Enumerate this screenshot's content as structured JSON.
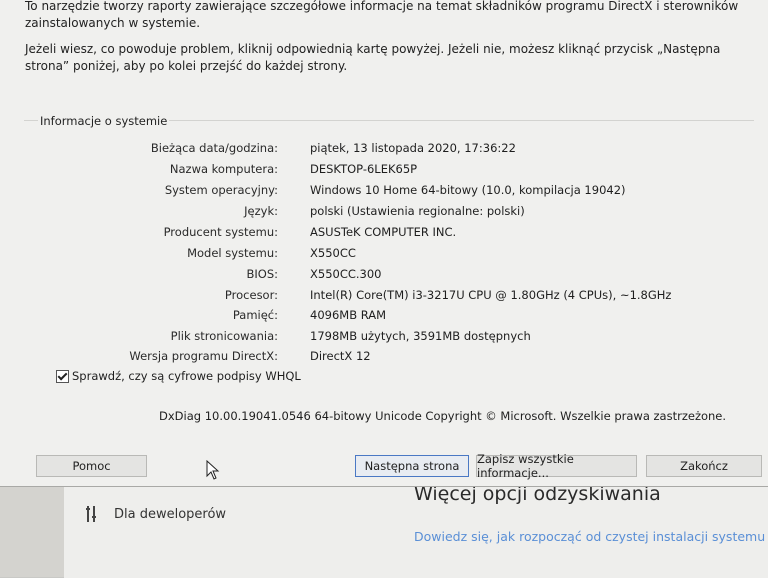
{
  "intro": {
    "line1": "To narzędzie tworzy raporty zawierające szczegółowe informacje na temat składników programu DirectX i sterowników zainstalowanych w systemie.",
    "line2": "Jeżeli wiesz, co powoduje problem, kliknij odpowiednią kartę powyżej. Jeżeli nie, możesz kliknąć przycisk „Następna strona” poniżej, aby po kolei przejść do każdej strony."
  },
  "system_info": {
    "group_label": "Informacje o systemie",
    "rows": [
      {
        "label": "Bieżąca data/godzina:",
        "value": "piątek, 13 listopada 2020, 17:36:22"
      },
      {
        "label": "Nazwa komputera:",
        "value": "DESKTOP-6LEK65P"
      },
      {
        "label": "System operacyjny:",
        "value": "Windows 10 Home 64-bitowy (10.0, kompilacja 19042)"
      },
      {
        "label": "Język:",
        "value": "polski (Ustawienia regionalne: polski)"
      },
      {
        "label": "Producent systemu:",
        "value": "ASUSTeK COMPUTER INC."
      },
      {
        "label": "Model systemu:",
        "value": "X550CC"
      },
      {
        "label": "BIOS:",
        "value": "X550CC.300"
      },
      {
        "label": "Procesor:",
        "value": "Intel(R) Core(TM) i3-3217U CPU @ 1.80GHz (4 CPUs), ~1.8GHz"
      },
      {
        "label": "Pamięć:",
        "value": "4096MB RAM"
      },
      {
        "label": "Plik stronicowania:",
        "value": "1798MB użytych, 3591MB dostępnych"
      },
      {
        "label": "Wersja programu DirectX:",
        "value": "DirectX 12"
      }
    ],
    "whql_checkbox_label": "Sprawdź, czy są cyfrowe podpisy WHQL",
    "whql_checked": true,
    "copyright": "DxDiag 10.00.19041.0546 64-bitowy Unicode  Copyright © Microsoft. Wszelkie prawa zastrzeżone."
  },
  "buttons": {
    "help": "Pomoc",
    "next_page": "Następna strona",
    "save_all": "Zapisz wszystkie informacje...",
    "exit": "Zakończ"
  },
  "background_window": {
    "heading": "Więcej opcji odzyskiwania",
    "link": "Dowiedz się, jak rozpocząć od czystej instalacji systemu",
    "dev_item": "Dla deweloperów"
  }
}
